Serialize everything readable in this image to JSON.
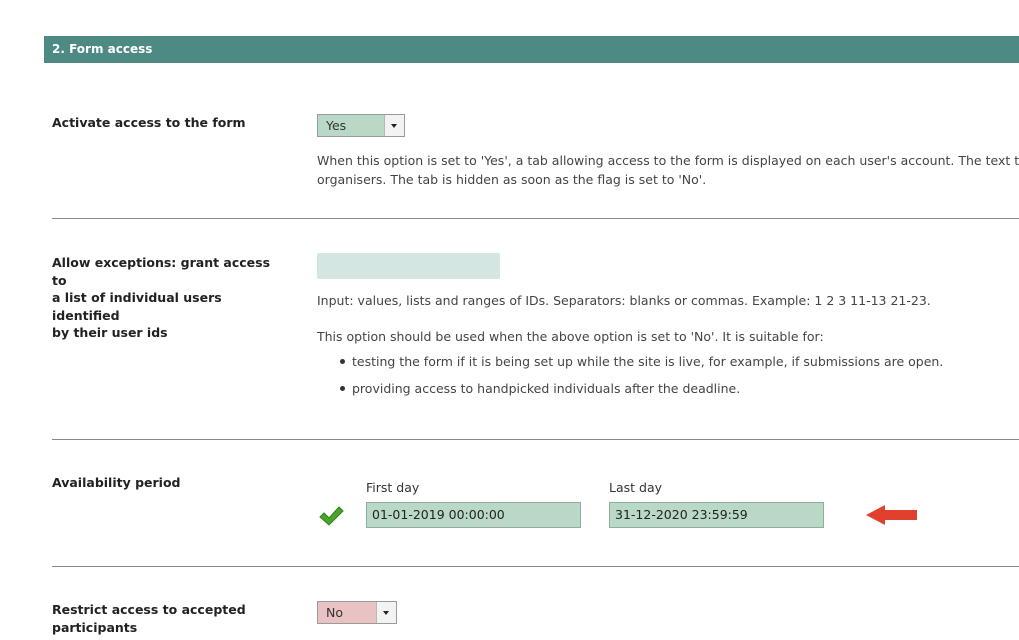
{
  "section": {
    "title": "2. Form access"
  },
  "activate": {
    "label": "Activate access to the form",
    "select_value": "Yes",
    "desc_line1": "When this option is set to 'Yes', a tab allowing access to the form is displayed on each user's account. The text that ap",
    "desc_line2": "organisers. The tab is hidden as soon as the flag is set to 'No'."
  },
  "exceptions": {
    "label_line1": "Allow exceptions: grant access to",
    "label_line2": "a list of individual users identified",
    "label_line3": "by their user ids",
    "input_value": "",
    "input_hint": "Input: values, lists and ranges of IDs. Separators: blanks or commas. Example: 1 2 3 11-13 21-23.",
    "usage_intro": "This option should be used when the above option is set to 'No'. It is suitable for:",
    "bullets": [
      "testing the form if it is being set up while the site is live, for example, if submissions are open.",
      "providing access to handpicked individuals after the deadline."
    ]
  },
  "availability": {
    "label": "Availability period",
    "first_day_label": "First day",
    "first_day_value": "01-01-2019 00:00:00",
    "last_day_label": "Last day",
    "last_day_value": "31-12-2020 23:59:59",
    "status_icon": "checkmark-icon",
    "pointer_icon": "arrow-left-icon"
  },
  "restrict": {
    "label_line1": "Restrict access to accepted",
    "label_line2": "participants",
    "select_value": "No"
  },
  "colors": {
    "header_bg": "#4e8a84",
    "green_field": "#b9d9c6",
    "light_field": "#d3e6e2",
    "red_field": "#e9c3c3",
    "arrow_red": "#e2402e",
    "check_green": "#49a52a"
  }
}
